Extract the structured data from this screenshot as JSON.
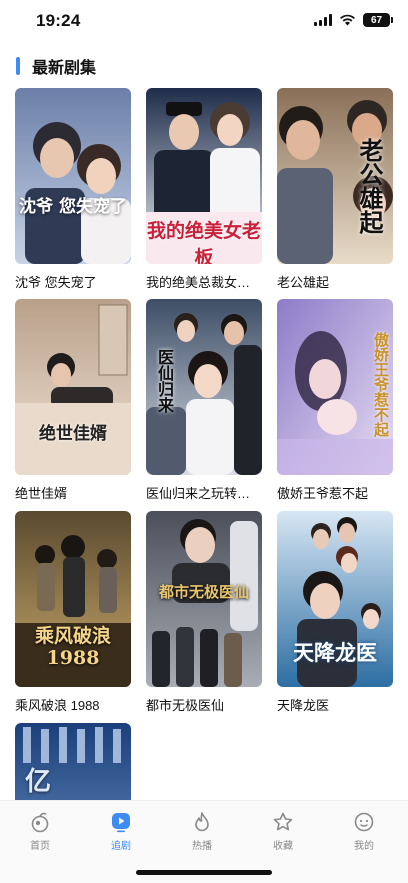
{
  "status_bar": {
    "time": "19:24",
    "battery": "67"
  },
  "section": {
    "title": "最新剧集"
  },
  "dramas": [
    {
      "title": "沈爷 您失宠了",
      "poster_text": "沈爷 您失宠了",
      "colors": [
        "#6b7fa8",
        "#c7d2e6"
      ]
    },
    {
      "title": "我的绝美总裁女老板",
      "poster_text": "我的绝美女老板",
      "colors": [
        "#1f2d4a",
        "#e9eef5"
      ]
    },
    {
      "title": "老公雄起",
      "poster_text": "老公雄起",
      "colors": [
        "#8a6f58",
        "#e8dcc8"
      ]
    },
    {
      "title": "绝世佳婿",
      "poster_text": "绝世佳婿",
      "colors": [
        "#b9a08a",
        "#f1e4d6"
      ]
    },
    {
      "title": "医仙归来之玩转都市",
      "poster_text": "医仙归来",
      "colors": [
        "#3d4e66",
        "#d9dce4"
      ]
    },
    {
      "title": "傲娇王爷惹不起",
      "poster_text": "傲娇王爷惹不起",
      "colors": [
        "#8e7bc8",
        "#e7ddf3"
      ]
    },
    {
      "title": "乘风破浪 1988",
      "poster_text": "乘风破浪 1988",
      "colors": [
        "#5a4a2f",
        "#c9a96b"
      ]
    },
    {
      "title": "都市无极医仙",
      "poster_text": "都市无极医仙",
      "colors": [
        "#4a4f5a",
        "#a9adb5"
      ]
    },
    {
      "title": "天降龙医",
      "poster_text": "天降龙医",
      "colors": [
        "#2d6ea3",
        "#d6e6f3"
      ]
    },
    {
      "title": "",
      "poster_text": "亿",
      "colors": [
        "#1b3f7a",
        "#6f97c9"
      ]
    }
  ],
  "tabs": [
    {
      "label": "首页",
      "icon": "home-icon",
      "active": false
    },
    {
      "label": "追剧",
      "icon": "play-icon",
      "active": true
    },
    {
      "label": "热播",
      "icon": "flame-icon",
      "active": false
    },
    {
      "label": "收藏",
      "icon": "star-icon",
      "active": false
    },
    {
      "label": "我的",
      "icon": "profile-icon",
      "active": false
    }
  ],
  "colors": {
    "accent": "#3f8cf0",
    "tab_inactive": "#888888"
  }
}
